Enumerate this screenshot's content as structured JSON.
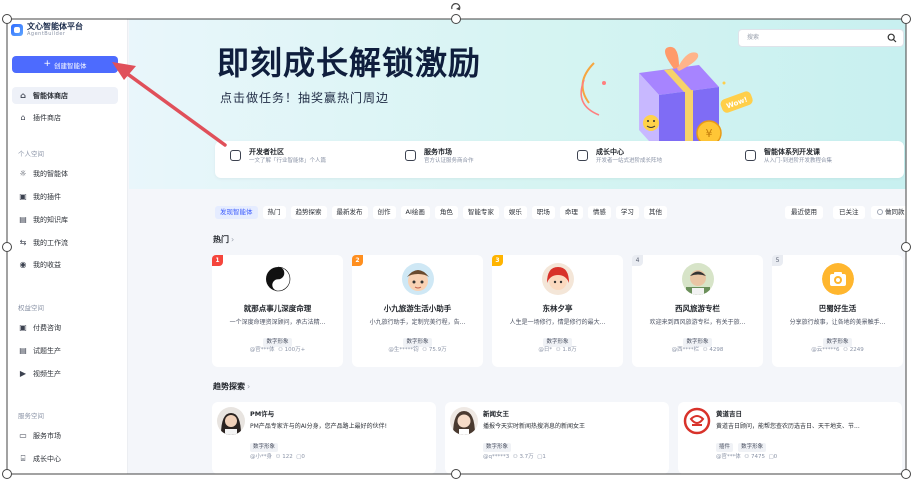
{
  "logo": {
    "title": "文心智能体平台",
    "subtitle": "AgentBuilder"
  },
  "sidebar": {
    "create_label": "创建智能体",
    "top_items": [
      {
        "label": "智能体商店",
        "icon": "store-icon"
      },
      {
        "label": "插件商店",
        "icon": "home-icon"
      }
    ],
    "sections": [
      {
        "title": "个人空间",
        "items": [
          {
            "label": "我的智能体",
            "icon": "agent-icon"
          },
          {
            "label": "我的插件",
            "icon": "plugin-icon"
          },
          {
            "label": "我的知识库",
            "icon": "knowledge-icon"
          },
          {
            "label": "我的工作流",
            "icon": "workflow-icon"
          },
          {
            "label": "我的收益",
            "icon": "income-icon"
          }
        ]
      },
      {
        "title": "权益空间",
        "items": [
          {
            "label": "付费咨询",
            "icon": "consult-icon"
          },
          {
            "label": "试题生产",
            "icon": "exam-icon"
          },
          {
            "label": "视频生产",
            "icon": "video-icon"
          }
        ]
      },
      {
        "title": "服务空间",
        "items": [
          {
            "label": "服务市场",
            "icon": "market-icon"
          },
          {
            "label": "成长中心",
            "icon": "growth-icon"
          }
        ]
      }
    ]
  },
  "banner": {
    "title": "即刻成长解锁激励",
    "subtitle": "点击做任务！抽奖赢热门周边",
    "search_placeholder": "搜索",
    "gift_badge": "Wow!"
  },
  "features": [
    {
      "title": "开发者社区",
      "desc": "一文了解「行业智能体」个人篇",
      "icon": "community-icon"
    },
    {
      "title": "服务市场",
      "desc": "官方认证服务商合作",
      "icon": "service-icon"
    },
    {
      "title": "成长中心",
      "desc": "开发者一站式进阶成长阵地",
      "icon": "growth-center-icon"
    },
    {
      "title": "智能体系列开发课",
      "desc": "从入门-到进阶开发教程合集",
      "icon": "course-icon"
    }
  ],
  "filters": [
    "发现智能体",
    "热门",
    "趋势探索",
    "最新发布",
    "创作",
    "AI绘画",
    "角色",
    "智能专家",
    "娱乐",
    "职场",
    "命理",
    "情感",
    "学习",
    "其他"
  ],
  "sort": {
    "recent": "最近使用",
    "followed": "已关注",
    "only_label": "做同款"
  },
  "hot": {
    "title": "热门",
    "cards": [
      {
        "rank": "1",
        "name": "就那点事儿深度命理",
        "desc": "一个深度命理资深顾问，承古法精...",
        "tag": "数字形象",
        "author": "@官***体",
        "users": "100万+",
        "rank_color": "#f5453c",
        "avatar": "yinyang"
      },
      {
        "rank": "2",
        "name": "小九旅游生活小助手",
        "desc": "小九旅行助手，定制完美行程，告...",
        "tag": "数字形象",
        "author": "@生*****钧",
        "users": "75.9万",
        "rank_color": "#ff8f1f",
        "avatar": "boy"
      },
      {
        "rank": "3",
        "name": "东林夕亭",
        "desc": "人生是一场修行，情是修行的最大...",
        "tag": "数字形象",
        "author": "@日*",
        "users": "1.8万",
        "rank_color": "#ffb400",
        "avatar": "redhair"
      },
      {
        "rank": "4",
        "name": "西风旅游专栏",
        "desc": "欢迎来到西风旅游专栏，有关于旅...",
        "tag": "数字形象",
        "author": "@西****栏",
        "users": "4298",
        "rank_color": "",
        "avatar": "man"
      },
      {
        "rank": "5",
        "name": "巴蜀好生活",
        "desc": "分享旅行故事，让各地的美景触手...",
        "tag": "数字形象",
        "author": "@云*****6",
        "users": "2249",
        "rank_color": "",
        "avatar": "camera"
      }
    ]
  },
  "trend": {
    "title": "趋势探索",
    "cards": [
      {
        "name": "PM许与",
        "desc": "PM产品专家许与的AI分身，您产品路上最好的伙伴!",
        "tags": [
          "数字形象"
        ],
        "author": "@小**身",
        "users": "122",
        "comments": "0",
        "avatar": "woman"
      },
      {
        "name": "新闻女王",
        "desc": "播报今天实时新闻热搜消息的新闻女王",
        "tags": [
          "数字形象"
        ],
        "author": "@q*****3",
        "users": "3.7万",
        "comments": "1",
        "avatar": "girl"
      },
      {
        "name": "黄道吉日",
        "desc": "黄道吉日顾问，能帮您查农历选吉日、天干地支、节...",
        "tags": [
          "插件",
          "数字形象"
        ],
        "author": "@官***体",
        "users": "7475",
        "comments": "0",
        "avatar": "seal"
      }
    ]
  },
  "colors": {
    "accent": "#4d6bfe",
    "arrow": "#e0505a"
  }
}
